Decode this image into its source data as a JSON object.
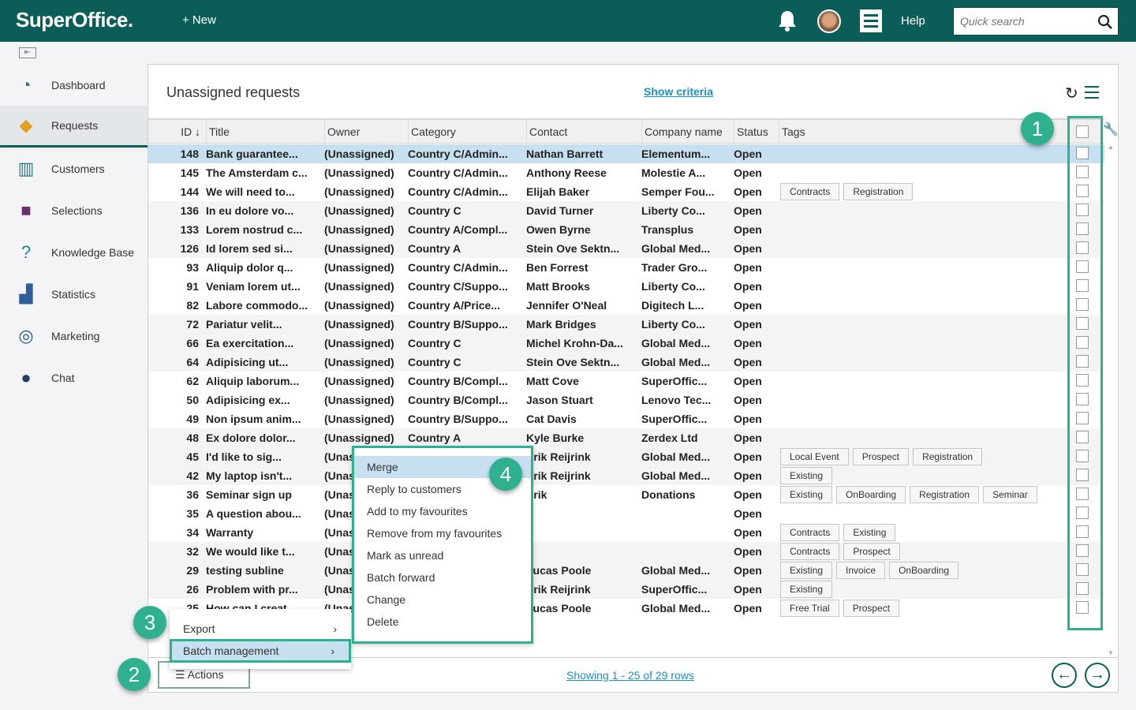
{
  "header": {
    "logo": "SuperOffice.",
    "new_label": "+ New",
    "help": "Help",
    "search_placeholder": "Quick search"
  },
  "sidebar": {
    "items": [
      {
        "label": "Dashboard",
        "icon": "dashboard-gauge-icon"
      },
      {
        "label": "Requests",
        "icon": "ticket-icon",
        "active": true
      },
      {
        "label": "Customers",
        "icon": "building-icon"
      },
      {
        "label": "Selections",
        "icon": "selection-icon"
      },
      {
        "label": "Knowledge Base",
        "icon": "question-icon"
      },
      {
        "label": "Statistics",
        "icon": "bar-chart-icon"
      },
      {
        "label": "Marketing",
        "icon": "target-icon"
      },
      {
        "label": "Chat",
        "icon": "chat-bubble-icon"
      }
    ]
  },
  "panel": {
    "title": "Unassigned requests",
    "show_criteria": "Show criteria",
    "columns": [
      "ID ↓",
      "Title",
      "Owner",
      "Category",
      "Contact",
      "Company name",
      "Status",
      "Tags"
    ],
    "rows": [
      [
        "148",
        "Bank guarantee...",
        "(Unassigned)",
        "Country C/Admin...",
        "Nathan Barrett",
        "Elementum...",
        "Open",
        []
      ],
      [
        "145",
        "The Amsterdam c...",
        "(Unassigned)",
        "Country C/Admin...",
        "Anthony Reese",
        "Molestie A...",
        "Open",
        []
      ],
      [
        "144",
        "We will need to...",
        "(Unassigned)",
        "Country C/Admin...",
        "Elijah Baker",
        "Semper Fou...",
        "Open",
        [
          "Contracts",
          "Registration"
        ]
      ],
      [
        "136",
        "In eu dolore vo...",
        "(Unassigned)",
        "Country C",
        "David Turner",
        "Liberty Co...",
        "Open",
        []
      ],
      [
        "133",
        "Lorem nostrud c...",
        "(Unassigned)",
        "Country A/Compl...",
        "Owen Byrne",
        "Transplus",
        "Open",
        []
      ],
      [
        "126",
        "Id lorem sed si...",
        "(Unassigned)",
        "Country A",
        "Stein Ove Sektn...",
        "Global Med...",
        "Open",
        []
      ],
      [
        "93",
        "Aliquip dolor q...",
        "(Unassigned)",
        "Country C/Admin...",
        "Ben Forrest",
        "Trader Gro...",
        "Open",
        []
      ],
      [
        "91",
        "Veniam lorem ut...",
        "(Unassigned)",
        "Country C/Suppo...",
        "Matt Brooks",
        "Liberty Co...",
        "Open",
        []
      ],
      [
        "82",
        "Labore commodo...",
        "(Unassigned)",
        "Country A/Price...",
        "Jennifer O'Neal",
        "Digitech L...",
        "Open",
        []
      ],
      [
        "72",
        "Pariatur velit...",
        "(Unassigned)",
        "Country B/Suppo...",
        "Mark Bridges",
        "Liberty Co...",
        "Open",
        []
      ],
      [
        "66",
        "Ea exercitation...",
        "(Unassigned)",
        "Country C",
        "Michel Krohn-Da...",
        "Global Med...",
        "Open",
        []
      ],
      [
        "64",
        "Adipisicing ut...",
        "(Unassigned)",
        "Country C",
        "Stein Ove Sektn...",
        "Global Med...",
        "Open",
        []
      ],
      [
        "62",
        "Aliquip laborum...",
        "(Unassigned)",
        "Country B/Compl...",
        "Matt Cove",
        "SuperOffic...",
        "Open",
        []
      ],
      [
        "50",
        "Adipisicing ex...",
        "(Unassigned)",
        "Country B/Compl...",
        "Jason Stuart",
        "Lenovo Tec...",
        "Open",
        []
      ],
      [
        "49",
        "Non ipsum anim...",
        "(Unassigned)",
        "Country B/Suppo...",
        "Cat Davis",
        "SuperOffic...",
        "Open",
        []
      ],
      [
        "48",
        "Ex dolore dolor...",
        "(Unassigned)",
        "Country A",
        "Kyle Burke",
        "Zerdex Ltd",
        "Open",
        []
      ],
      [
        "45",
        "I'd like to sig...",
        "(Unassigned)",
        "",
        "Erik Reijrink",
        "Global Med...",
        "Open",
        [
          "Local Event",
          "Prospect",
          "Registration"
        ]
      ],
      [
        "42",
        "My laptop isn't...",
        "(Unassigned)",
        "",
        "Erik Reijrink",
        "Global Med...",
        "Open",
        [
          "Existing"
        ]
      ],
      [
        "36",
        "Seminar sign up",
        "(Unassigned)",
        "",
        "Erik",
        "Donations",
        "Open",
        [
          "Existing",
          "OnBoarding",
          "Registration",
          "Seminar"
        ]
      ],
      [
        "35",
        "A question abou...",
        "(Unassigned)",
        "",
        "",
        "",
        "Open",
        []
      ],
      [
        "34",
        "Warranty",
        "(Unassigned)",
        "",
        "",
        "",
        "Open",
        [
          "Contracts",
          "Existing"
        ]
      ],
      [
        "32",
        "We would like t...",
        "(Unassigned)",
        "",
        "",
        "",
        "Open",
        [
          "Contracts",
          "Prospect"
        ]
      ],
      [
        "29",
        "testing subline",
        "(Unassigned)",
        "",
        "Lucas Poole",
        "Global Med...",
        "Open",
        [
          "Existing",
          "Invoice",
          "OnBoarding"
        ]
      ],
      [
        "26",
        "Problem with pr...",
        "(Unassigned)",
        "",
        "Erik Reijrink",
        "SuperOffic...",
        "Open",
        [
          "Existing"
        ]
      ],
      [
        "25",
        "How can I creat...",
        "(Unassigned)",
        "",
        "Lucas Poole",
        "Global Med...",
        "Open",
        [
          "Free Trial",
          "Prospect"
        ]
      ]
    ],
    "showing": "Showing 1 - 25 of 29 rows",
    "actions": "☰ Actions"
  },
  "actions_menu": {
    "items": [
      "Export",
      "Batch management"
    ]
  },
  "batch_menu": {
    "items": [
      "Merge",
      "Reply to customers",
      "Add to my favourites",
      "Remove from my favourites",
      "Mark as unread",
      "Batch forward",
      "Change",
      "Delete"
    ]
  },
  "badges": [
    "1",
    "2",
    "3",
    "4"
  ],
  "colors": {
    "header": "#0b5e58",
    "highlight": "#2fb08f",
    "selected_row": "#c6e0f0",
    "link": "#1d8fc7"
  }
}
